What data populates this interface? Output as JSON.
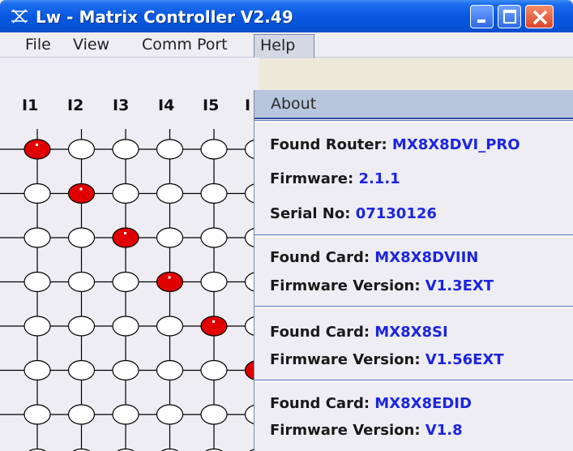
{
  "window": {
    "title": "Lw - Matrix Controller V2.49"
  },
  "menu": {
    "file": "File",
    "view": "View",
    "comm_port": "Comm Port",
    "help": "Help"
  },
  "matrix": {
    "inputs": [
      "I1",
      "I2",
      "I3",
      "I4",
      "I5",
      "I"
    ],
    "active_color": "#e00000",
    "routing": [
      {
        "row": 1,
        "col": 1
      },
      {
        "row": 2,
        "col": 2
      },
      {
        "row": 3,
        "col": 3
      },
      {
        "row": 4,
        "col": 4
      },
      {
        "row": 5,
        "col": 5
      },
      {
        "row": 6,
        "col": 6
      }
    ]
  },
  "help_menu": {
    "about": "About",
    "router": {
      "found_label": "Found Router: ",
      "found_value": "MX8X8DVI_PRO",
      "firmware_label": "Firmware: ",
      "firmware_value": "2.1.1",
      "serial_label": "Serial No: ",
      "serial_value": "07130126"
    },
    "cards": [
      {
        "found_label": "Found Card: ",
        "found_value": "MX8X8DVIIN",
        "fw_label": "Firmware Version: ",
        "fw_value": "V1.3EXT"
      },
      {
        "found_label": "Found Card: ",
        "found_value": "MX8X8SI",
        "fw_label": "Firmware Version: ",
        "fw_value": "V1.56EXT"
      },
      {
        "found_label": "Found Card: ",
        "found_value": "MX8X8EDID",
        "fw_label": "Firmware Version: ",
        "fw_value": "V1.8"
      }
    ]
  },
  "colors": {
    "value_text": "#1d25e0",
    "titlebar": "#0a58e0"
  }
}
